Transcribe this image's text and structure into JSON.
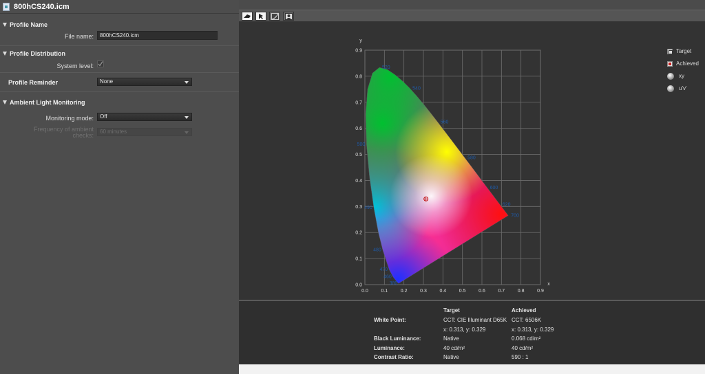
{
  "window": {
    "title": "800hCS240.icm"
  },
  "profile_name": {
    "heading": "Profile Name",
    "file_name_label": "File name:",
    "file_name_value": "800hCS240.icm"
  },
  "profile_distribution": {
    "heading": "Profile Distribution",
    "system_level_label": "System level:",
    "system_level_checked": true
  },
  "profile_reminder": {
    "heading": "Profile Reminder",
    "value": "None"
  },
  "ambient": {
    "heading": "Ambient Light Monitoring",
    "mode_label": "Monitoring mode:",
    "mode_value": "Off",
    "freq_label_1": "Frequency of ambient",
    "freq_label_2": "checks:",
    "freq_value": "60 minutes"
  },
  "toolbar": {
    "icons": [
      "gamut-view-icon",
      "cursor-icon",
      "curve-icon",
      "profile-icon"
    ],
    "active": 0
  },
  "legend": {
    "target": "Target",
    "achieved": "Achieved",
    "xy": "xy",
    "uv": "u'v'"
  },
  "chart_data": {
    "type": "scatter",
    "xlabel": "x",
    "ylabel": "y",
    "xlim": [
      0,
      0.9
    ],
    "ylim": [
      0,
      0.9
    ],
    "x_ticks": [
      "0.0",
      "0.1",
      "0.2",
      "0.3",
      "0.4",
      "0.5",
      "0.6",
      "0.7",
      "0.8",
      "0.9"
    ],
    "y_ticks": [
      "0.0",
      "0.1",
      "0.2",
      "0.3",
      "0.4",
      "0.5",
      "0.6",
      "0.7",
      "0.8",
      "0.9"
    ],
    "grid": true,
    "wavelength_labels": [
      {
        "label": "520",
        "x": 0.074,
        "y": 0.834
      },
      {
        "label": "540",
        "x": 0.23,
        "y": 0.754
      },
      {
        "label": "560",
        "x": 0.373,
        "y": 0.624
      },
      {
        "label": "580",
        "x": 0.512,
        "y": 0.487
      },
      {
        "label": "600",
        "x": 0.627,
        "y": 0.372
      },
      {
        "label": "620",
        "x": 0.691,
        "y": 0.308
      },
      {
        "label": "700",
        "x": 0.735,
        "y": 0.265
      },
      {
        "label": "500",
        "x": 0.008,
        "y": 0.538
      },
      {
        "label": "490",
        "x": 0.045,
        "y": 0.295
      },
      {
        "label": "480",
        "x": 0.091,
        "y": 0.133
      },
      {
        "label": "470",
        "x": 0.124,
        "y": 0.058
      },
      {
        "label": "460",
        "x": 0.144,
        "y": 0.03
      },
      {
        "label": "380",
        "x": 0.174,
        "y": 0.005
      }
    ],
    "points": [
      {
        "name": "Achieved",
        "x": 0.313,
        "y": 0.329
      }
    ]
  },
  "summary": {
    "col_target": "Target",
    "col_achieved": "Achieved",
    "white_point_label": "White Point:",
    "wp_target_cct": "CCT: CIE Illuminant D65K",
    "wp_achieved_cct": "CCT: 6506K",
    "wp_target_xy": "x: 0.313, y: 0.329",
    "wp_achieved_xy": "x: 0.313, y: 0.329",
    "black_label": "Black Luminance:",
    "black_target": "Native",
    "black_achieved": "0.068 cd/m²",
    "lum_label": "Luminance:",
    "lum_target": "40 cd/m²",
    "lum_achieved": "40 cd/m²",
    "contrast_label": "Contrast Ratio:",
    "contrast_target": "Native",
    "contrast_achieved": "590 : 1"
  }
}
